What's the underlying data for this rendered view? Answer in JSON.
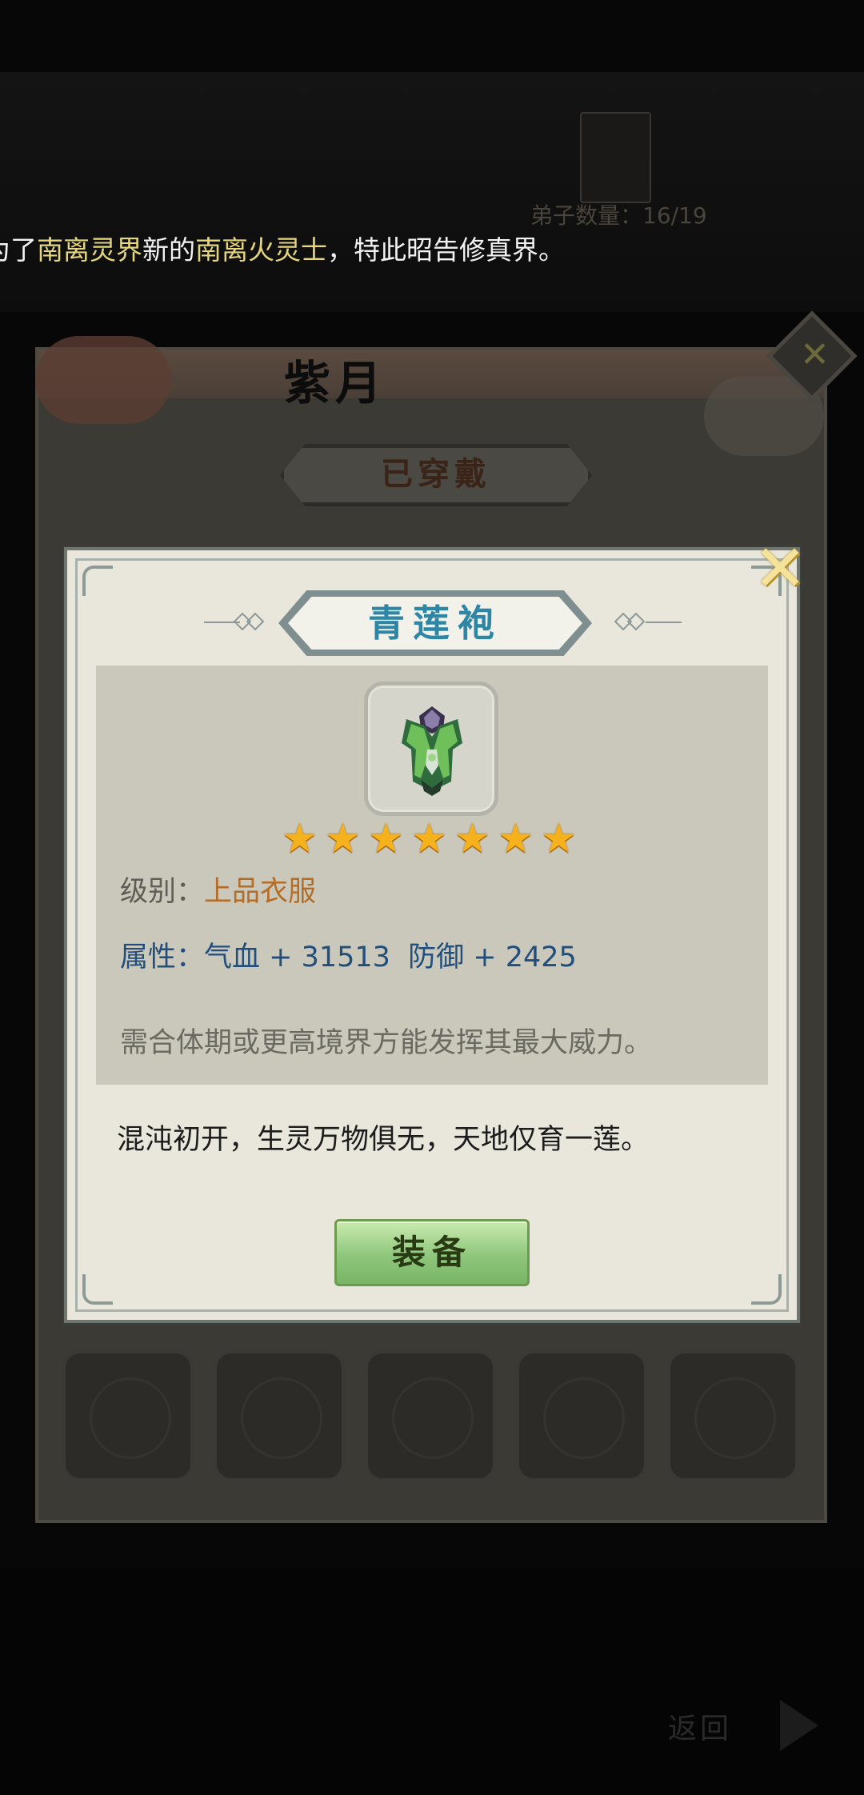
{
  "background": {
    "count_text": "弟子数量：16/19",
    "announcement": {
      "prefix": "为了",
      "realm": "南离灵界",
      "middle": "新的",
      "title": "南离火灵士",
      "suffix": "，特此昭告修真界。"
    },
    "panel_title": "紫月",
    "panel_tab": "已穿戴",
    "return_label": "返回"
  },
  "item": {
    "name": "青莲袍",
    "stars": 7,
    "level_label": "级别：",
    "level_value": "上品衣服",
    "attr_text": "属性：气血 + 31513  防御 + 2425",
    "requirement": "需合体期或更高境界方能发挥其最大威力。",
    "flavor": "混沌初开，生灵万物俱无，天地仅育一莲。",
    "equip_label": "装备"
  },
  "colors": {
    "highlight": "#e6d77a",
    "item_name": "#2e86a7",
    "level_value": "#b46d26",
    "attr": "#214e7c",
    "star": "#f6b21c"
  },
  "icons": {
    "close": "close-x-icon",
    "star": "star-icon",
    "item": "green-armor-robe-icon"
  }
}
